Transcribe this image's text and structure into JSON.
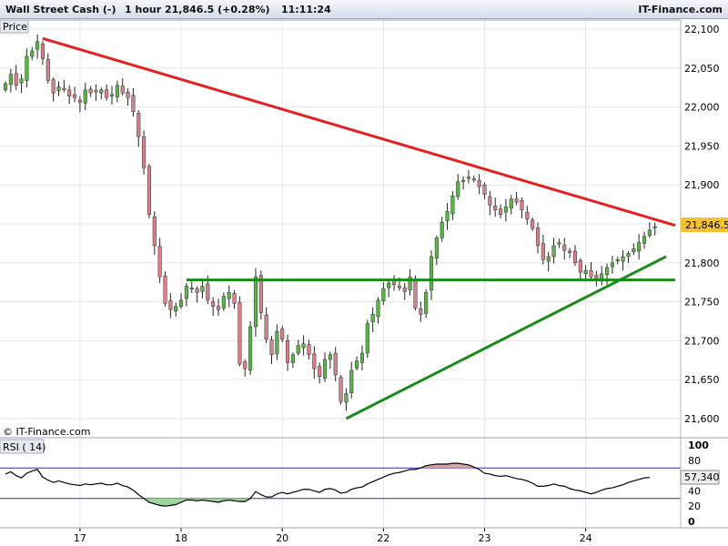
{
  "header": {
    "instrument": "Wall Street Cash (-)",
    "timeframe": "1 hour",
    "quote": "21,846.5 (+0.28%)",
    "time": "11:11:24",
    "brand": "IT-Finance.com"
  },
  "price_panel": {
    "label": "Price",
    "watermark": "© IT-Finance.com",
    "last_price_label": "21,846.5"
  },
  "rsi_panel": {
    "label": "RSI ( 14)",
    "last_value_label": "57,340"
  },
  "colors": {
    "up": "#5ab547",
    "down": "#d8808a",
    "resistance": "#e22222",
    "support": "#1a8a1a",
    "grid": "#e4e6ea",
    "rsi_line": "#000000",
    "rsi_band": "#3030a0"
  },
  "chart_data": [
    {
      "type": "candlestick",
      "title": "Wall Street Cash (-)",
      "ylabel": "Price",
      "ylim": [
        21570,
        22110
      ],
      "y_ticks": [
        "22,100",
        "22,050",
        "22,000",
        "21,950",
        "21,900",
        "21,850",
        "21,800",
        "21,750",
        "21,700",
        "21,650",
        "21,600"
      ],
      "y_tick_values": [
        22100,
        22050,
        22000,
        21950,
        21900,
        21850,
        21800,
        21750,
        21700,
        21650,
        21600
      ],
      "x_ticks": [
        "17",
        "18",
        "20",
        "22",
        "23",
        "24"
      ],
      "x_tick_bars": [
        14,
        33,
        52,
        71,
        90,
        109
      ],
      "bar_count": 123,
      "close": [
        22030,
        22042,
        22028,
        22036,
        22065,
        22072,
        22084,
        22062,
        22034,
        22018,
        22026,
        22022,
        22014,
        22012,
        22006,
        22022,
        22018,
        22020,
        22022,
        22012,
        22016,
        22028,
        22018,
        22012,
        21994,
        21962,
        21922,
        21862,
        21822,
        21782,
        21748,
        21740,
        21744,
        21752,
        21770,
        21768,
        21762,
        21770,
        21752,
        21744,
        21740,
        21757,
        21762,
        21748,
        21670,
        21664,
        21718,
        21782,
        21736,
        21702,
        21682,
        21712,
        21702,
        21672,
        21682,
        21694,
        21696,
        21682,
        21664,
        21654,
        21676,
        21682,
        21656,
        21622,
        21632,
        21662,
        21674,
        21684,
        21722,
        21734,
        21752,
        21767,
        21774,
        21772,
        21768,
        21763,
        21782,
        21742,
        21734,
        21762,
        21808,
        21832,
        21852,
        21866,
        21886,
        21904,
        21906,
        21910,
        21906,
        21898,
        21888,
        21874,
        21868,
        21862,
        21872,
        21882,
        21878,
        21868,
        21856,
        21844,
        21822,
        21804,
        21808,
        21822,
        21826,
        21816,
        21814,
        21800,
        21788,
        21790,
        21782,
        21780,
        21786,
        21794,
        21800,
        21804,
        21808,
        21812,
        21818,
        21826,
        21834,
        21842,
        21846.5
      ],
      "rsi": [
        62,
        65,
        60,
        57,
        63,
        66,
        68,
        58,
        54,
        51,
        53,
        51,
        49,
        48,
        47,
        49,
        48,
        49,
        50,
        48,
        48,
        50,
        47,
        45,
        41,
        35,
        30,
        25,
        23,
        21,
        20,
        21,
        22,
        25,
        28,
        28,
        27,
        28,
        27,
        26,
        25,
        27,
        28,
        27,
        26,
        26,
        30,
        39,
        35,
        32,
        32,
        36,
        38,
        36,
        38,
        40,
        42,
        42,
        40,
        38,
        42,
        43,
        41,
        37,
        38,
        42,
        44,
        45,
        49,
        52,
        55,
        58,
        61,
        63,
        64,
        66,
        68,
        68,
        70,
        73,
        74,
        75,
        75,
        75,
        76,
        76,
        75,
        74,
        71,
        68,
        63,
        62,
        60,
        59,
        60,
        58,
        56,
        55,
        53,
        50,
        46,
        46,
        47,
        49,
        47,
        46,
        43,
        41,
        40,
        38,
        36,
        38,
        41,
        43,
        44,
        46,
        48,
        51,
        53,
        55,
        57,
        57.34
      ],
      "rsi_ticks": [
        "100",
        "80",
        "60",
        "40",
        "20",
        "0"
      ],
      "rsi_tick_values": [
        100,
        80,
        60,
        40,
        20,
        0
      ],
      "rsi_bands": [
        70,
        30
      ]
    }
  ]
}
